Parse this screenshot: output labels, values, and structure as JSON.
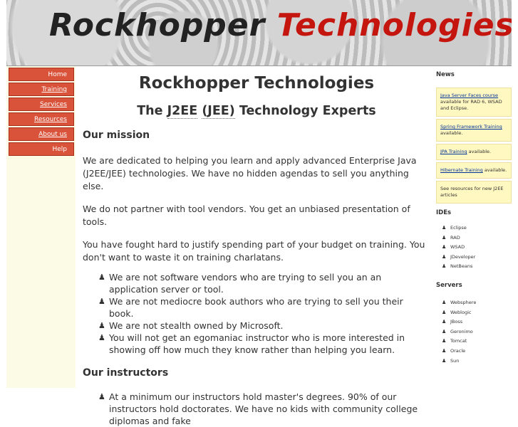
{
  "banner": {
    "part1": "Rockhopper",
    "part2": "Technologies"
  },
  "nav": [
    {
      "label": "Home"
    },
    {
      "label": "Training"
    },
    {
      "label": "Services"
    },
    {
      "label": "Resources"
    },
    {
      "label": "About us"
    },
    {
      "label": "Help"
    }
  ],
  "main": {
    "title": "Rockhopper Technologies",
    "subtitle_prefix": "The",
    "subtitle_acr1": "J2EE",
    "subtitle_acr2": "(JEE)",
    "subtitle_suffix": "Technology Experts",
    "mission_heading": "Our mission",
    "p1": "We are dedicated to helping you learn and apply advanced Enterprise Java (J2EE/JEE) technologies. We have no hidden agendas to sell you anything else.",
    "p2": "We do not partner with tool vendors. You get an unbiased presentation of tools.",
    "p3": "You have fought hard to justify spending part of your budget on training. You don't want to waste it on training charlatans.",
    "mission_bullets": [
      "We are not software vendors who are trying to sell you an an application server or tool.",
      "We are not mediocre book authors who are trying to sell you their book.",
      "We are not stealth owned by Microsoft.",
      "You will not get an egomaniac instructor who is more interested in showing off how much they know rather than helping you learn."
    ],
    "instructors_heading": "Our instructors",
    "instructor_bullets": [
      "At a minimum our instructors hold master's degrees. 90% of our instructors hold doctorates. We have no kids with community college diplomas and fake"
    ]
  },
  "side": {
    "news_heading": "News",
    "news": [
      {
        "link": "Java Server Faces course",
        "text": " available for RAD 6, WSAD and Eclipse."
      },
      {
        "link": "Spring Framework Training",
        "text": " available."
      },
      {
        "link": "JPA Training",
        "text": " available."
      },
      {
        "link": "Hibernate Training",
        "text": " available."
      },
      {
        "link": "",
        "text": "See resources for new J2EE articles"
      }
    ],
    "ides_heading": "IDEs",
    "ides": [
      "Eclipse",
      "RAD",
      "WSAD",
      "JDeveloper",
      "NetBeans"
    ],
    "servers_heading": "Servers",
    "servers": [
      "Websphere",
      "Weblogic",
      "JBoss",
      "Geronimo",
      "Tomcat",
      "Oracle",
      "Sun"
    ]
  }
}
